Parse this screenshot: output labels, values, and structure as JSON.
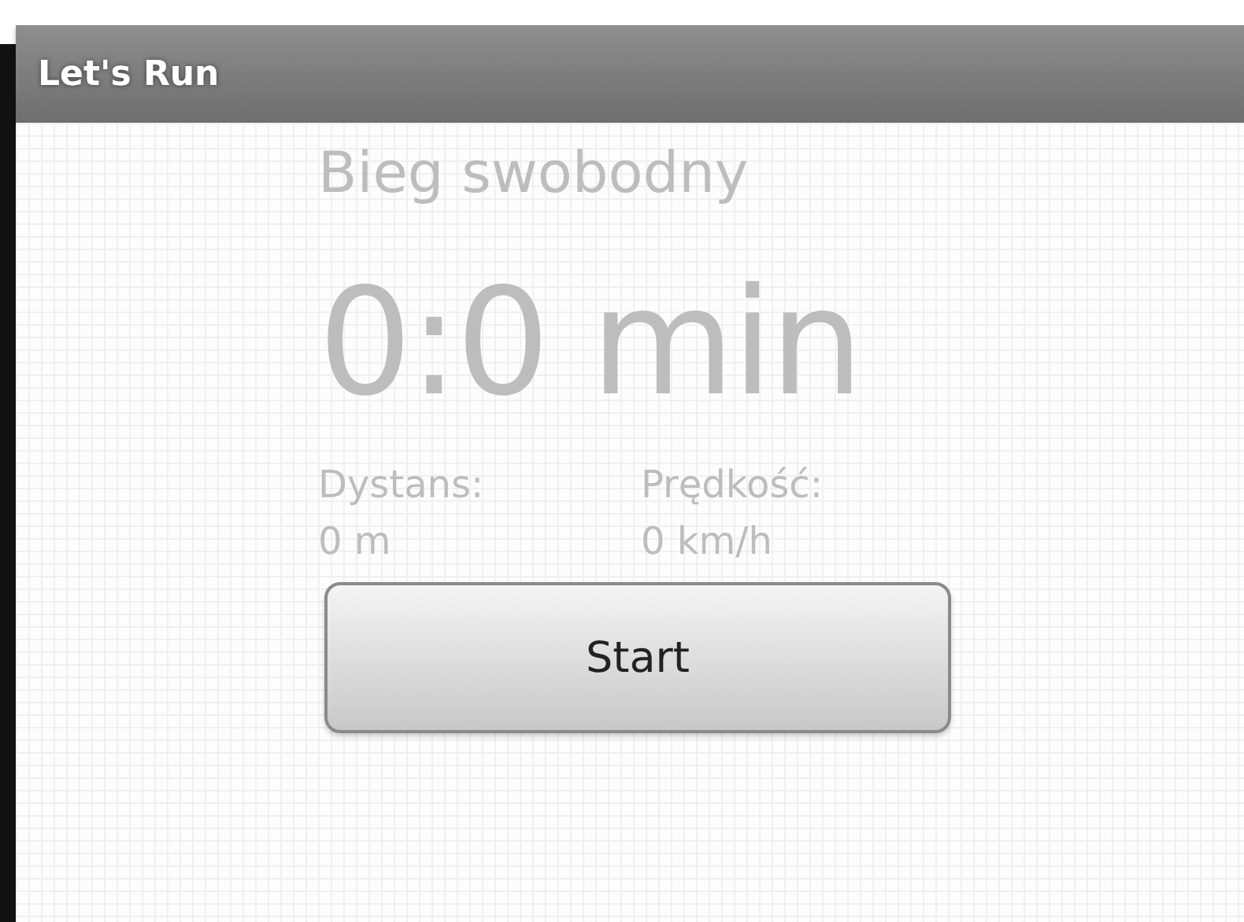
{
  "window": {
    "title": "Let's Run"
  },
  "mode_title": "Bieg swobodny",
  "time": "0:0 min",
  "stats": [
    {
      "label": "Dystans:",
      "value": "0 m"
    },
    {
      "label": "Prędkość:",
      "value": "0 km/h"
    }
  ],
  "button": {
    "label": "Start"
  }
}
